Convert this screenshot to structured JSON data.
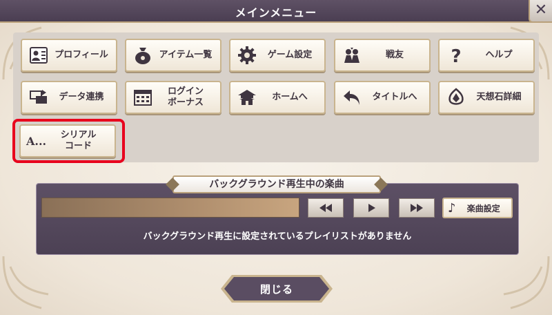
{
  "header": {
    "title": "メインメニュー",
    "close_icon": "close-icon"
  },
  "menu": {
    "items": [
      {
        "label": "プロフィール",
        "icon": "profile-card-icon"
      },
      {
        "label": "アイテム一覧",
        "icon": "item-bag-icon"
      },
      {
        "label": "ゲーム設定",
        "icon": "gear-icon"
      },
      {
        "label": "戦友",
        "icon": "friends-icon"
      },
      {
        "label": "ヘルプ",
        "icon": "help-icon"
      },
      {
        "label": "データ連携",
        "icon": "data-transfer-icon"
      },
      {
        "label": "ログイン\nボーナス",
        "icon": "calendar-icon"
      },
      {
        "label": "ホームへ",
        "icon": "home-castle-icon"
      },
      {
        "label": "タイトルへ",
        "icon": "return-arrow-icon"
      },
      {
        "label": "天想石詳細",
        "icon": "gem-icon"
      },
      {
        "label": "シリアル\nコード",
        "icon": "serial-text-icon",
        "icon_text": "A..."
      }
    ]
  },
  "bgm": {
    "header": "バックグラウンド再生中の楽曲",
    "controls": {
      "rewind": "rewind-icon",
      "play": "play-icon",
      "fast_forward": "fast-forward-icon"
    },
    "music_setting_label": "楽曲設定",
    "music_setting_icon": "music-note-icon",
    "music_note_glyph": "♪",
    "status": "バックグラウンド再生に設定されているプレイリストがありません"
  },
  "footer": {
    "close_label": "閉じる"
  },
  "colors": {
    "title_bar": "#4a3e52",
    "highlight": "#e8001d",
    "gold_border": "#c9b48e"
  }
}
